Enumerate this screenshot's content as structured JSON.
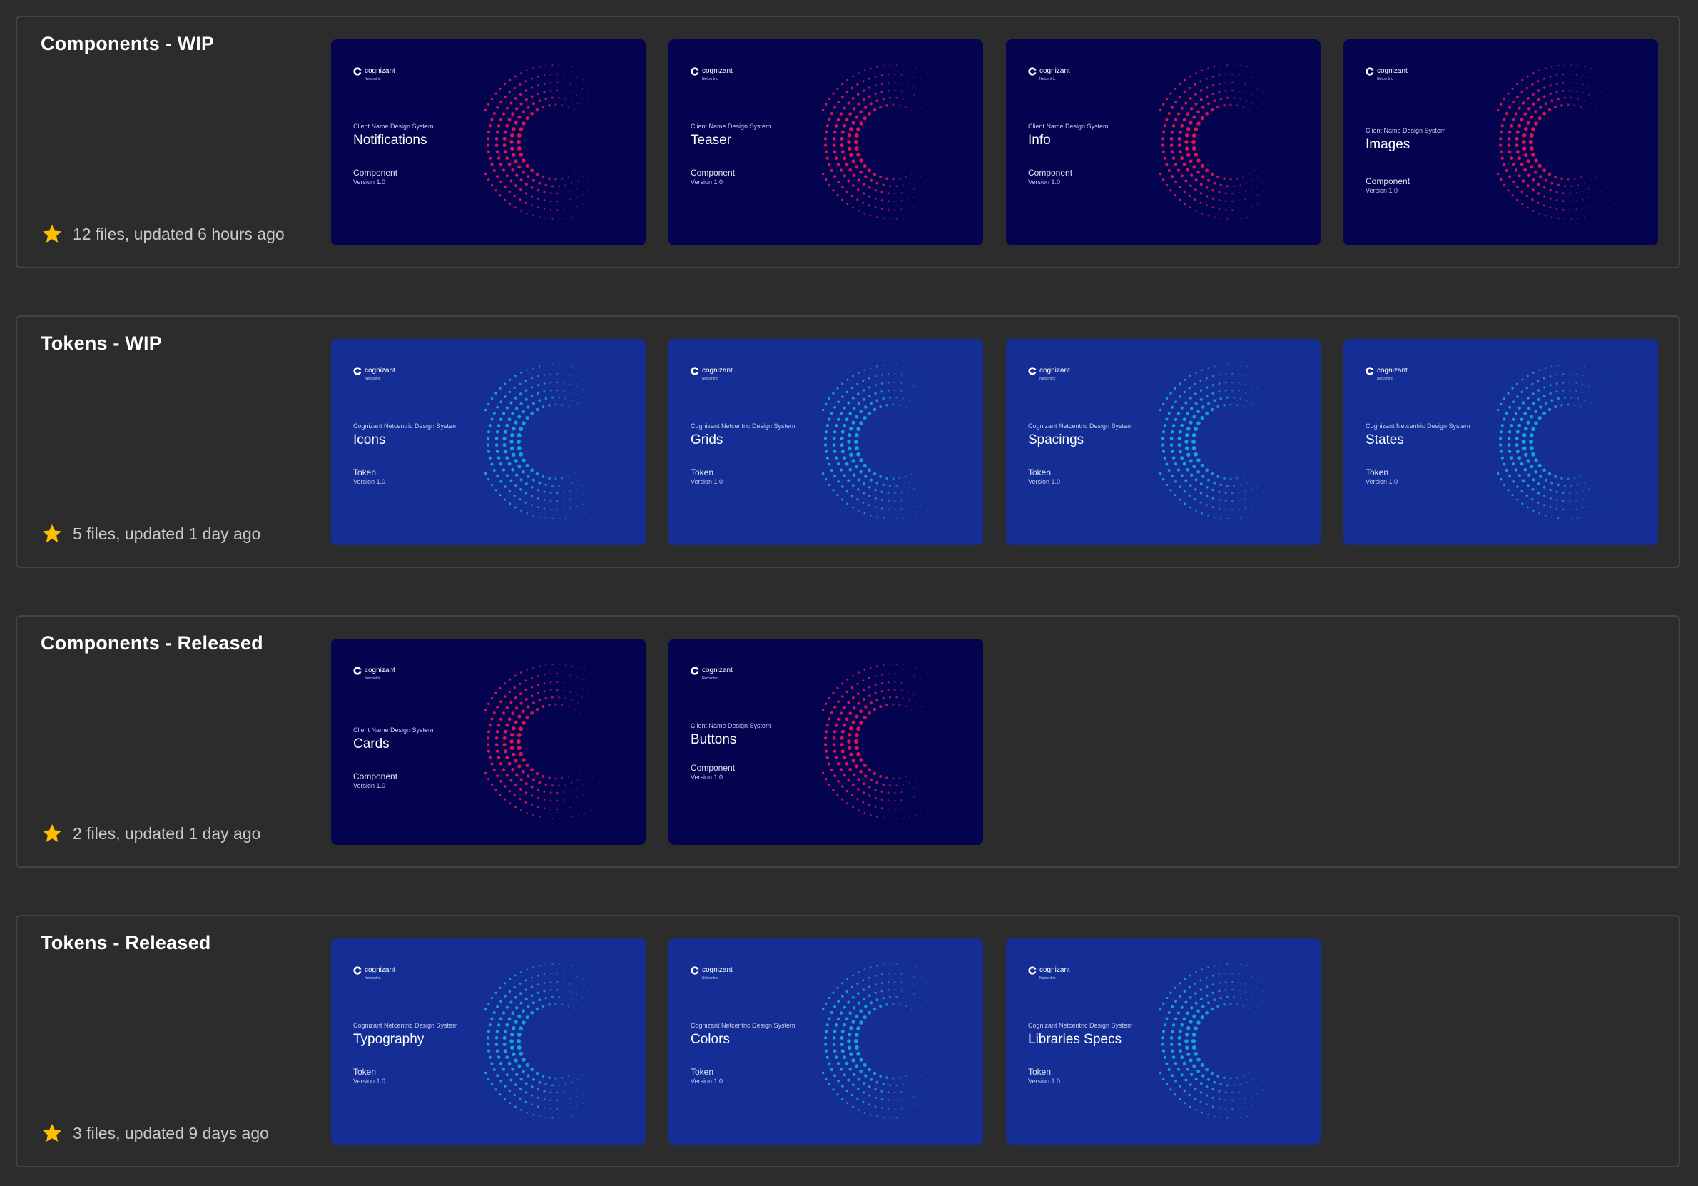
{
  "colors": {
    "background": "#2c2c2c",
    "card_border": "#444444",
    "star": "#ffbf00",
    "component_bg": "#03034f",
    "token_bg": "#142e96",
    "component_dot_main": "#e0124f",
    "component_dot_fade": "#5e1a6e",
    "token_dot_main": "#12a3e0",
    "token_dot_fade": "#1d54b8"
  },
  "projects": [
    {
      "name": "Components - WIP",
      "meta": "12 files, updated 6 hours ago",
      "kind": "component",
      "files": [
        {
          "brand": "cognizant",
          "brand_sub": "Netcentric",
          "system": "Client Name Design System",
          "title": "Notifications",
          "kind": "Component",
          "version": "Version 1.0"
        },
        {
          "brand": "cognizant",
          "brand_sub": "Netcentric",
          "system": "Client Name Design System",
          "title": "Teaser",
          "kind": "Component",
          "version": "Version 1.0"
        },
        {
          "brand": "cognizant",
          "brand_sub": "Netcentric",
          "system": "Client Name Design System",
          "title": "Info",
          "kind": "Component",
          "version": "Version 1.0"
        },
        {
          "brand": "cognizant",
          "brand_sub": "Netcentric",
          "system": "Client Name Design System",
          "title": "Images",
          "kind": "Component",
          "version": "Version 1.0"
        }
      ]
    },
    {
      "name": "Tokens - WIP",
      "meta": "5 files, updated 1 day ago",
      "kind": "token",
      "files": [
        {
          "brand": "cognizant",
          "brand_sub": "Netcentric",
          "system": "Cognizant Netcentric Design System",
          "title": "Icons",
          "kind": "Token",
          "version": "Version 1.0"
        },
        {
          "brand": "cognizant",
          "brand_sub": "Netcentric",
          "system": "Cognizant Netcentric Design System",
          "title": "Grids",
          "kind": "Token",
          "version": "Version 1.0"
        },
        {
          "brand": "cognizant",
          "brand_sub": "Netcentric",
          "system": "Cognizant Netcentric Design System",
          "title": "Spacings",
          "kind": "Token",
          "version": "Version 1.0"
        },
        {
          "brand": "cognizant",
          "brand_sub": "Netcentric",
          "system": "Cognizant Netcentric Design System",
          "title": "States",
          "kind": "Token",
          "version": "Version 1.0"
        }
      ]
    },
    {
      "name": "Components - Released",
      "meta": "2 files, updated 1 day ago",
      "kind": "component",
      "files": [
        {
          "brand": "cognizant",
          "brand_sub": "Netcentric",
          "system": "Client Name Design System",
          "title": "Cards",
          "kind": "Component",
          "version": "Version 1.0"
        },
        {
          "brand": "cognizant",
          "brand_sub": "Netcentric",
          "system": "Client Name Design System",
          "title": "Buttons",
          "kind": "Component",
          "version": "Version 1.0"
        }
      ]
    },
    {
      "name": "Tokens - Released",
      "meta": "3 files, updated 9 days ago",
      "kind": "token",
      "files": [
        {
          "brand": "cognizant",
          "brand_sub": "Netcentric",
          "system": "Cognizant Netcentric Design System",
          "title": "Typography",
          "kind": "Token",
          "version": "Version 1.0"
        },
        {
          "brand": "cognizant",
          "brand_sub": "Netcentric",
          "system": "Cognizant Netcentric Design System",
          "title": "Colors",
          "kind": "Token",
          "version": "Version 1.0"
        },
        {
          "brand": "cognizant",
          "brand_sub": "Netcentric",
          "system": "Cognizant Netcentric Design System",
          "title": "Libraries Specs",
          "kind": "Token",
          "version": "Version 1.0"
        }
      ]
    }
  ]
}
